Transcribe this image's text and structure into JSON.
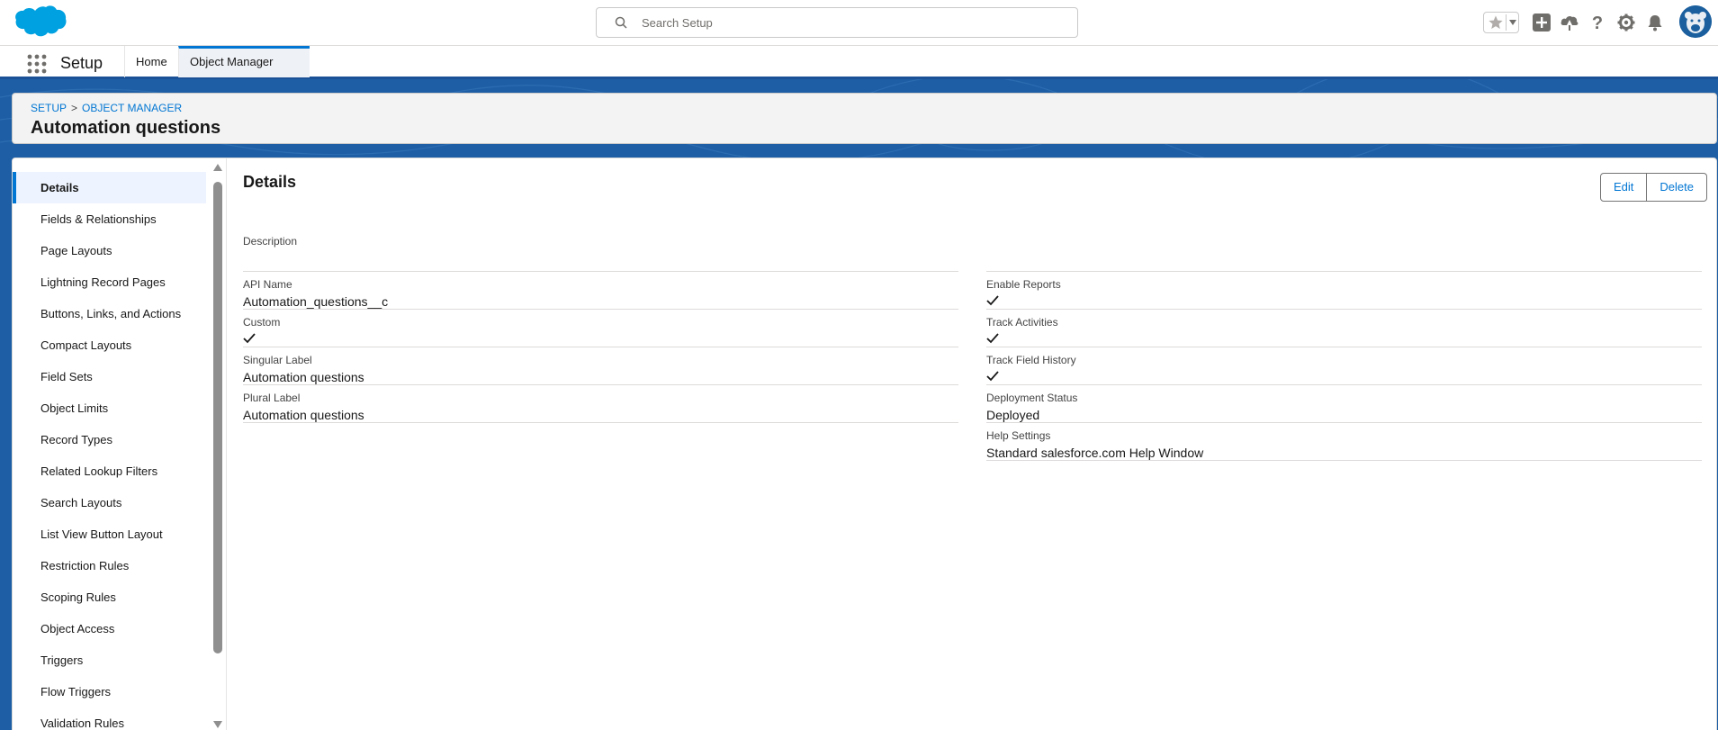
{
  "header": {
    "search_placeholder": "Search Setup",
    "icons": [
      "favorites-star-icon",
      "global-create-icon",
      "trailhead-icon",
      "help-icon",
      "setup-gear-icon",
      "notifications-bell-icon",
      "user-avatar"
    ]
  },
  "context_bar": {
    "app_name": "Setup",
    "tabs": [
      {
        "label": "Home"
      },
      {
        "label": "Object Manager"
      }
    ]
  },
  "page_header": {
    "breadcrumb": [
      "SETUP",
      "OBJECT MANAGER"
    ],
    "breadcrumb_separator": ">",
    "title": "Automation questions"
  },
  "sidebar": {
    "items": [
      {
        "label": "Details"
      },
      {
        "label": "Fields & Relationships"
      },
      {
        "label": "Page Layouts"
      },
      {
        "label": "Lightning Record Pages"
      },
      {
        "label": "Buttons, Links, and Actions"
      },
      {
        "label": "Compact Layouts"
      },
      {
        "label": "Field Sets"
      },
      {
        "label": "Object Limits"
      },
      {
        "label": "Record Types"
      },
      {
        "label": "Related Lookup Filters"
      },
      {
        "label": "Search Layouts"
      },
      {
        "label": "List View Button Layout"
      },
      {
        "label": "Restriction Rules"
      },
      {
        "label": "Scoping Rules"
      },
      {
        "label": "Object Access"
      },
      {
        "label": "Triggers"
      },
      {
        "label": "Flow Triggers"
      },
      {
        "label": "Validation Rules"
      }
    ]
  },
  "details": {
    "title": "Details",
    "edit_label": "Edit",
    "delete_label": "Delete",
    "description_label": "Description",
    "left_fields": [
      {
        "label": "API Name",
        "value": "Automation_questions__c"
      },
      {
        "label": "Custom",
        "value": "checked"
      },
      {
        "label": "Singular Label",
        "value": "Automation questions"
      },
      {
        "label": "Plural Label",
        "value": "Automation questions"
      }
    ],
    "right_fields": [
      {
        "label": "Enable Reports",
        "value": "checked"
      },
      {
        "label": "Track Activities",
        "value": "checked"
      },
      {
        "label": "Track Field History",
        "value": "checked"
      },
      {
        "label": "Deployment Status",
        "value": "Deployed"
      },
      {
        "label": "Help Settings",
        "value": "Standard salesforce.com Help Window"
      }
    ]
  },
  "colors": {
    "brand_blue": "#0176d3",
    "band_blue": "#1d5ea5",
    "logo_blue": "#00a1e0"
  }
}
